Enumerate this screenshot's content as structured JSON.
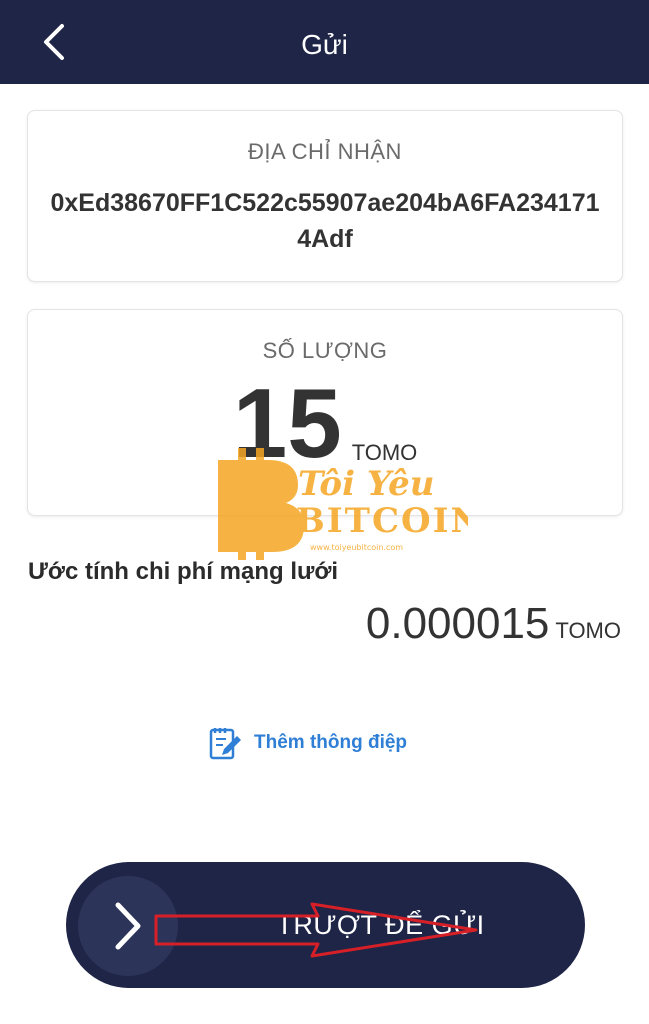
{
  "header": {
    "title": "Gửi",
    "back_icon": "chevron-left-icon"
  },
  "recipient": {
    "label": "ĐỊA CHỈ NHẬN",
    "address": "0xEd38670FF1C522c55907ae204bA6FA2341714Adf"
  },
  "amount": {
    "label": "SỐ LƯỢNG",
    "value": "15",
    "unit": "TOMO"
  },
  "fee": {
    "label": "Ước tính chi phí mạng lưới",
    "value": "0.000015",
    "unit": "TOMO"
  },
  "add_message": {
    "label": "Thêm thông điệp",
    "icon": "edit-note-icon"
  },
  "send_slider": {
    "label": "TRƯỢT ĐỂ GỬI",
    "icon": "chevron-right-icon"
  },
  "watermark": {
    "logo_text": "Tôi Yêu BITCOIN",
    "logo_url_text": "www.toiyeubitcoin.com",
    "repeat_text": "www.ToiYeuBitcoin.com"
  },
  "colors": {
    "header_bg": "#1f2547",
    "link_blue": "#2f7fd6",
    "annotation_red": "#d61f26",
    "logo_orange": "#f5a623"
  }
}
